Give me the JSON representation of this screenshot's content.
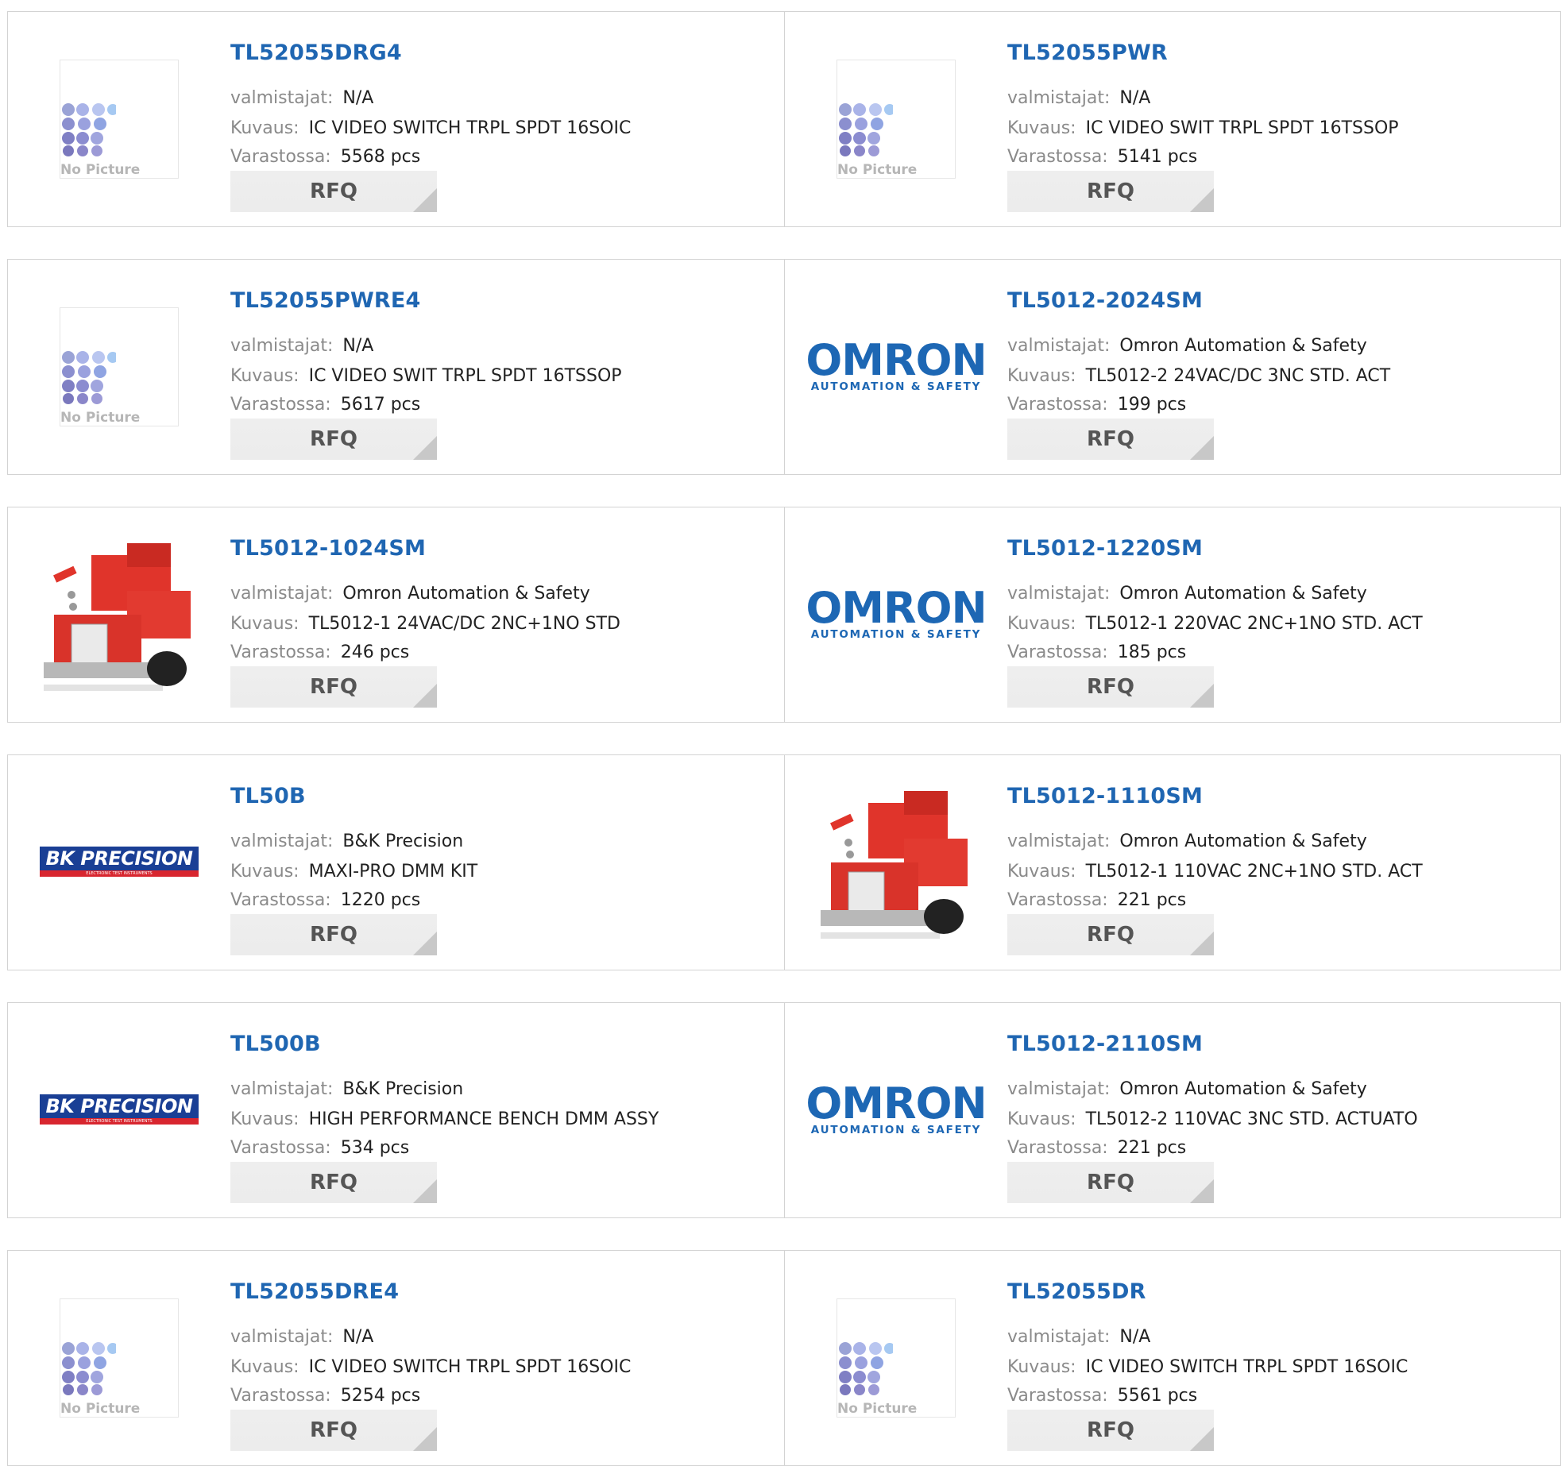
{
  "labels": {
    "manufacturer": "valmistajat:",
    "description": "Kuvaus:",
    "stock": "Varastossa:",
    "rfq": "RFQ",
    "no_picture": "No Picture"
  },
  "brand_logos": {
    "omron": {
      "name": "OMRON",
      "tagline": "AUTOMATION & SAFETY"
    },
    "bk": {
      "name": "BK PRECISION",
      "tagline": "ELECTRONIC TEST INSTRUMENTS"
    }
  },
  "products": [
    {
      "part": "TL52055DRG4",
      "manufacturer": "N/A",
      "description": "IC VIDEO SWITCH TRPL SPDT 16SOIC",
      "stock": "5568 pcs",
      "image": "no-picture"
    },
    {
      "part": "TL52055PWR",
      "manufacturer": "N/A",
      "description": "IC VIDEO SWIT TRPL SPDT 16TSSOP",
      "stock": "5141 pcs",
      "image": "no-picture"
    },
    {
      "part": "TL52055PWRE4",
      "manufacturer": "N/A",
      "description": "IC VIDEO SWIT TRPL SPDT 16TSSOP",
      "stock": "5617 pcs",
      "image": "no-picture"
    },
    {
      "part": "TL5012-2024SM",
      "manufacturer": "Omron Automation & Safety",
      "description": "TL5012-2 24VAC/DC 3NC STD. ACT",
      "stock": "199 pcs",
      "image": "omron-logo"
    },
    {
      "part": "TL5012-1024SM",
      "manufacturer": "Omron Automation & Safety",
      "description": "TL5012-1 24VAC/DC 2NC+1NO STD",
      "stock": "246 pcs",
      "image": "safety-switch-photo"
    },
    {
      "part": "TL5012-1220SM",
      "manufacturer": "Omron Automation & Safety",
      "description": "TL5012-1 220VAC 2NC+1NO STD. ACT",
      "stock": "185 pcs",
      "image": "omron-logo"
    },
    {
      "part": "TL50B",
      "manufacturer": "B&K Precision",
      "description": "MAXI-PRO DMM KIT",
      "stock": "1220 pcs",
      "image": "bk-precision-logo"
    },
    {
      "part": "TL5012-1110SM",
      "manufacturer": "Omron Automation & Safety",
      "description": "TL5012-1 110VAC 2NC+1NO STD. ACT",
      "stock": "221 pcs",
      "image": "safety-switch-photo"
    },
    {
      "part": "TL500B",
      "manufacturer": "B&K Precision",
      "description": "HIGH PERFORMANCE BENCH DMM ASSY",
      "stock": "534 pcs",
      "image": "bk-precision-logo"
    },
    {
      "part": "TL5012-2110SM",
      "manufacturer": "Omron Automation & Safety",
      "description": "TL5012-2 110VAC 3NC STD. ACTUATO",
      "stock": "221 pcs",
      "image": "omron-logo"
    },
    {
      "part": "TL52055DRE4",
      "manufacturer": "N/A",
      "description": "IC VIDEO SWITCH TRPL SPDT 16SOIC",
      "stock": "5254 pcs",
      "image": "no-picture"
    },
    {
      "part": "TL52055DR",
      "manufacturer": "N/A",
      "description": "IC VIDEO SWITCH TRPL SPDT 16SOIC",
      "stock": "5561 pcs",
      "image": "no-picture"
    }
  ],
  "colors": {
    "link": "#1f66b2",
    "label": "#8a8a8a",
    "omron_blue": "#1d67b4",
    "bk_blue": "#1a3f95",
    "bk_red": "#d8262f",
    "switch_red": "#e0342b"
  }
}
